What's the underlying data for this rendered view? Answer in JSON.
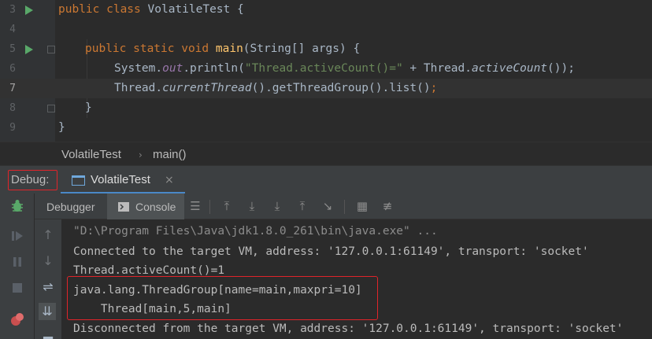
{
  "editor": {
    "line_numbers": [
      "3",
      "4",
      "5",
      "6",
      "7",
      "8",
      "9"
    ],
    "lines": {
      "l3": {
        "kw": "public class ",
        "rest": "VolatileTest {"
      },
      "l5": {
        "kw": "public static void ",
        "fn": "main",
        "rest": "(String[] args) {"
      },
      "l6": {
        "a": "System.",
        "b": "out",
        "c": ".println(",
        "d": "\"Thread.activeCount()=\"",
        "e": " + Thread.",
        "f": "activeCount",
        "g": "());"
      },
      "l7": {
        "a": "Thread.",
        "b": "currentThread",
        "c": "().getThreadGroup().list()",
        "d": ";"
      },
      "l8": "}",
      "l9": "}"
    }
  },
  "breadcrumb": {
    "items": [
      "VolatileTest",
      "main()"
    ],
    "separator": "›"
  },
  "debug": {
    "label": "Debug:",
    "tab_label": "VolatileTest",
    "close_glyph": "×",
    "tabs": [
      "Debugger",
      "Console"
    ]
  },
  "console": {
    "lines": [
      "\"D:\\Program Files\\Java\\jdk1.8.0_261\\bin\\java.exe\" ...",
      "Connected to the target VM, address: '127.0.0.1:61149', transport: 'socket'",
      "Thread.activeCount()=1",
      "java.lang.ThreadGroup[name=main,maxpri=10]",
      "    Thread[main,5,main]",
      "Disconnected from the target VM, address: '127.0.0.1:61149', transport: 'socket'"
    ]
  },
  "icons": {
    "run": "run-triangle-icon",
    "bug": "bug-icon",
    "resume": "resume-icon",
    "pause": "pause-icon",
    "stop": "stop-icon",
    "mute": "mute-breakpoints-icon"
  },
  "colors": {
    "accent_red": "#e0242a",
    "tab_underline": "#4a88c7",
    "run_green": "#59a869"
  }
}
